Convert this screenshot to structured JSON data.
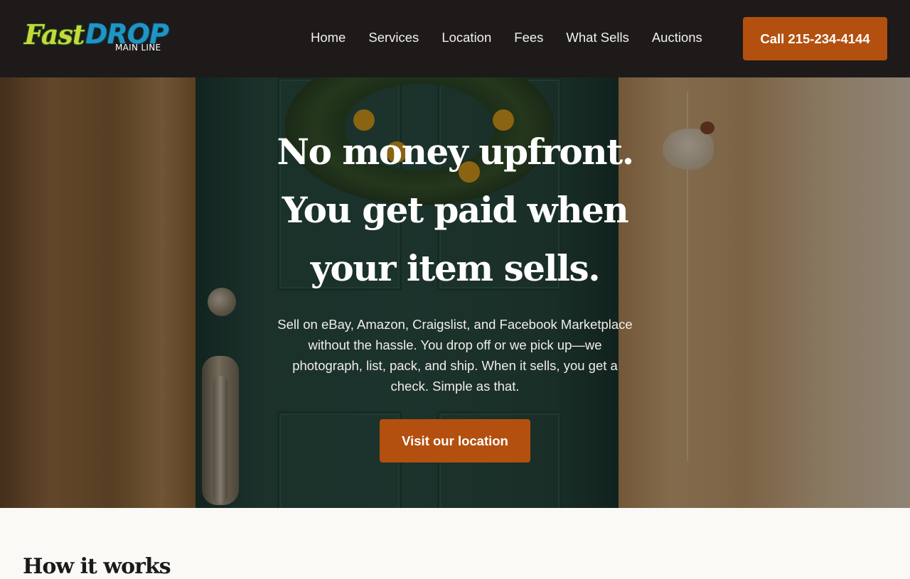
{
  "brand": {
    "logo_fast": "Fast",
    "logo_drop": "DROP",
    "logo_sub": "MAIN LINE",
    "accent_color": "#b3500f",
    "header_bg": "#1d1a19"
  },
  "nav": {
    "items": [
      {
        "label": "Home"
      },
      {
        "label": "Services"
      },
      {
        "label": "Location"
      },
      {
        "label": "Fees"
      },
      {
        "label": "What Sells"
      },
      {
        "label": "Auctions"
      }
    ],
    "call_label": "Call 215-234-4144"
  },
  "hero": {
    "title": "No money upfront. You get paid when your item sells.",
    "subtitle": "Sell on eBay, Amazon, Craigslist, and Facebook Marketplace without the hassle. You drop off or we pick up—we photograph, list, pack, and ship. When it sells, you get a check. Simple as that.",
    "cta_label": "Visit our location"
  },
  "how_it_works": {
    "title": "How it works"
  }
}
